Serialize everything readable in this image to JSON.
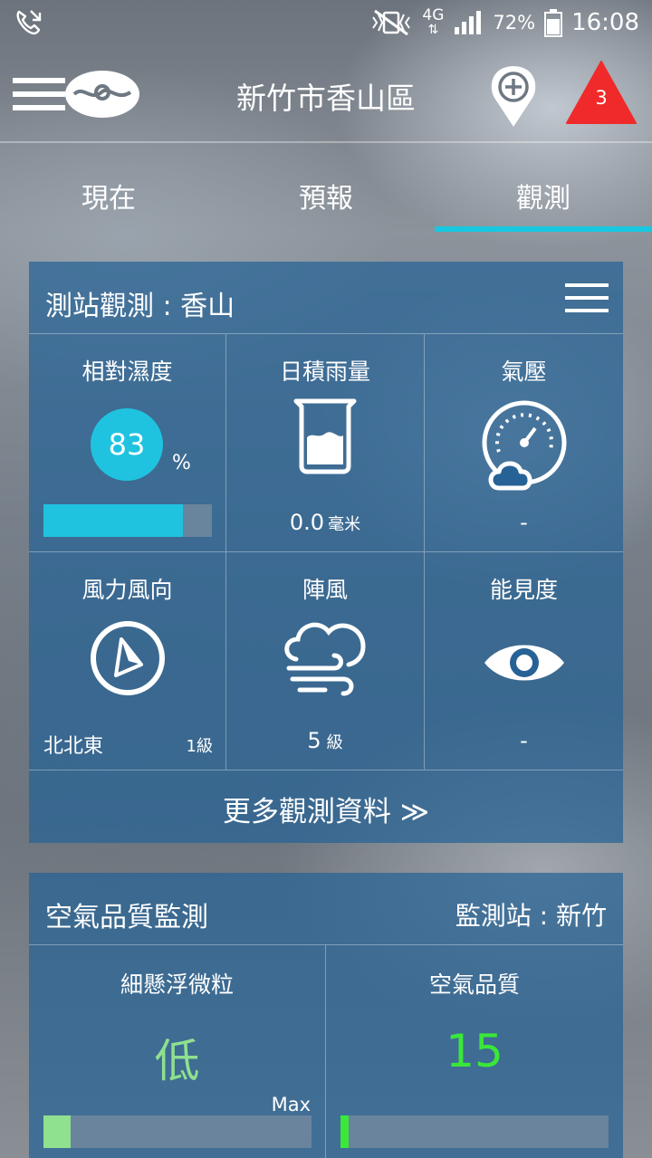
{
  "status_bar": {
    "network": "4G",
    "battery": "72%",
    "time": "16:08",
    "icons": [
      "phone-missed-icon",
      "vibrate-mute-icon",
      "signal-icon",
      "battery-icon"
    ]
  },
  "app_bar": {
    "city": "新竹市香山區",
    "warning_count": "3",
    "icons": [
      "menu-icon",
      "cwb-logo-icon",
      "add-location-icon",
      "warning-icon"
    ]
  },
  "tabs": [
    {
      "label": "現在",
      "active": false
    },
    {
      "label": "預報",
      "active": false
    },
    {
      "label": "觀測",
      "active": true
    }
  ],
  "accent_color": "#17c8e0",
  "station": {
    "title": "測站觀測 : 香山",
    "humidity": {
      "label": "相對濕度",
      "value": "83",
      "unit": "%",
      "level": 0.83
    },
    "rain": {
      "label": "日積雨量",
      "value": "0.0",
      "unit": "毫米"
    },
    "pressure": {
      "label": "氣壓",
      "value": "-"
    },
    "wind": {
      "label": "風力風向",
      "direction": "北北東",
      "level": "1級"
    },
    "gust": {
      "label": "陣風",
      "value": "5",
      "unit": "級"
    },
    "visibility": {
      "label": "能見度",
      "value": "-"
    },
    "more_label": "更多觀測資料 ≫"
  },
  "air_quality": {
    "title": "空氣品質監測",
    "station": "監測站 : 新竹",
    "pm": {
      "label": "細懸浮微粒",
      "value": "低",
      "max_label": "Max",
      "level": 0.1,
      "color": "#8fe08f"
    },
    "aqi": {
      "label": "空氣品質",
      "value": "15",
      "level": 0.03,
      "color": "#39e839"
    }
  }
}
